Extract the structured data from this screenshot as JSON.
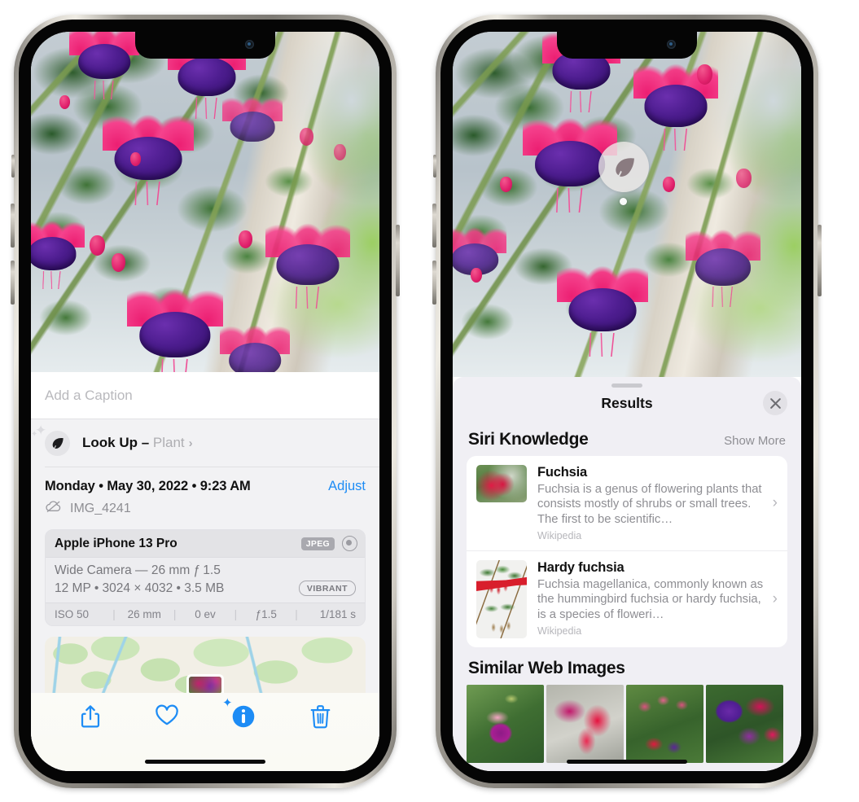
{
  "left_phone": {
    "caption": {
      "placeholder": "Add a Caption",
      "value": ""
    },
    "lookup": {
      "icon": "leaf-icon",
      "label": "Look Up",
      "dash": " – ",
      "kind": "Plant",
      "chevron": "›"
    },
    "date_line": "Monday • May 30, 2022 • 9:23 AM",
    "adjust_label": "Adjust",
    "file_name": "IMG_4241",
    "file_icon": "cloud-slash-icon",
    "camera": {
      "model": "Apple iPhone 13 Pro",
      "format_tag": "JPEG",
      "aperture_icon": "aperture-icon",
      "lens_line": "Wide Camera — 26 mm ƒ 1.5",
      "specs_line": "12 MP • 3024 × 4032 • 3.5 MB",
      "style_tag": "VIBRANT",
      "exif": [
        "ISO 50",
        "26 mm",
        "0 ev",
        "ƒ1.5",
        "1/181 s"
      ]
    },
    "toolbar": [
      {
        "name": "share-button",
        "icon": "share-icon"
      },
      {
        "name": "favorite-button",
        "icon": "heart-icon"
      },
      {
        "name": "info-button",
        "icon": "info-sparkle-icon"
      },
      {
        "name": "delete-button",
        "icon": "trash-icon"
      }
    ]
  },
  "right_phone": {
    "lookup_badge": {
      "icon": "leaf-icon"
    },
    "panel": {
      "title": "Results",
      "close_icon": "close-icon",
      "siri_knowledge": {
        "title": "Siri Knowledge",
        "show_more": "Show More",
        "items": [
          {
            "title": "Fuchsia",
            "description": "Fuchsia is a genus of flowering plants that consists mostly of shrubs or small trees. The first to be scientific…",
            "source": "Wikipedia",
            "chevron": "›"
          },
          {
            "title": "Hardy fuchsia",
            "description": "Fuchsia magellanica, commonly known as the hummingbird fuchsia or hardy fuchsia, is a species of floweri…",
            "source": "Wikipedia",
            "chevron": "›"
          }
        ]
      },
      "similar_web_images": {
        "title": "Similar Web Images",
        "tiles": [
          "fuchsia-thumb-1",
          "fuchsia-thumb-2",
          "fuchsia-thumb-3",
          "fuchsia-thumb-4"
        ]
      }
    }
  },
  "colors": {
    "accent_blue": "#1d8cf5",
    "panel_bg": "#f0eff4",
    "sheet_bg": "#f2f2f4",
    "secondary_text": "#8e8e93"
  }
}
